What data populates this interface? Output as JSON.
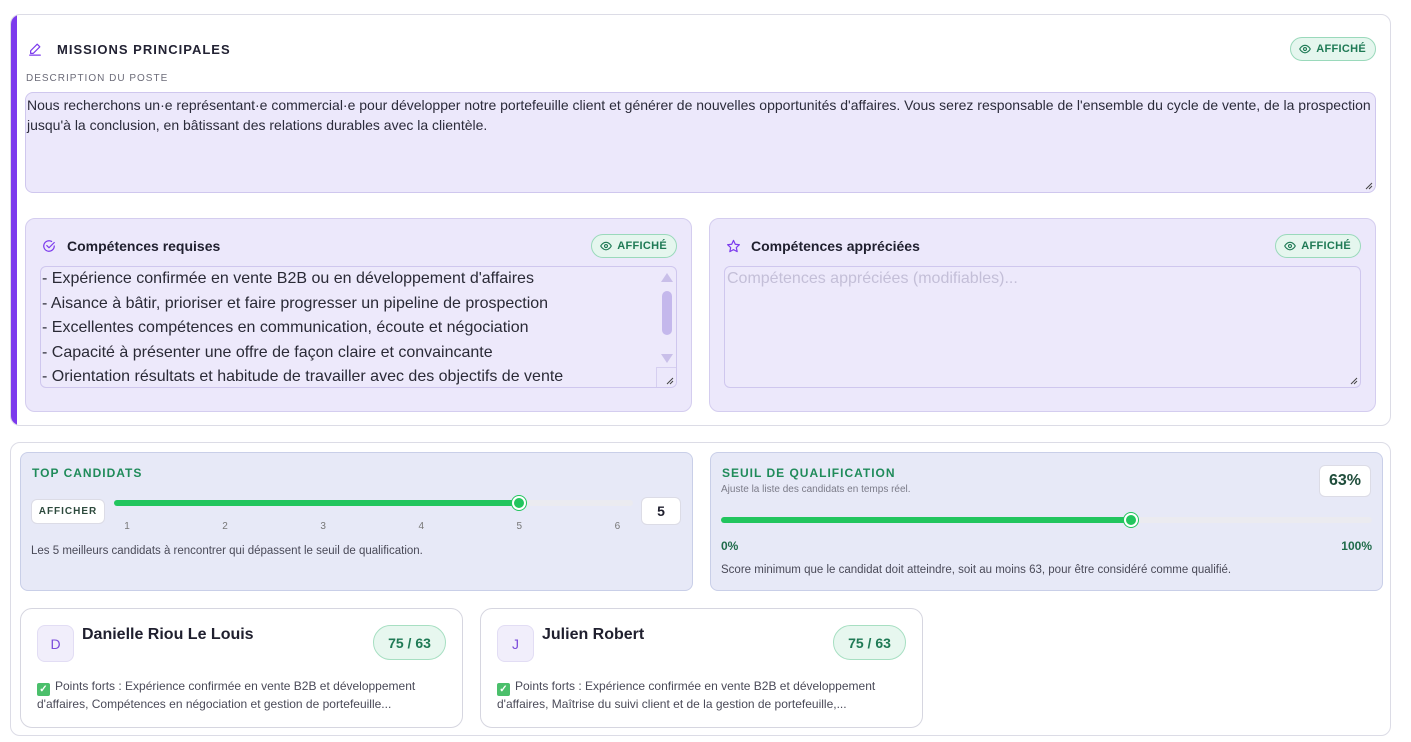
{
  "missions": {
    "title": "MISSIONS PRINCIPALES",
    "badge": "AFFICHÉ",
    "description_label": "DESCRIPTION DU POSTE",
    "description": "Nous recherchons un·e représentant·e commercial·e pour développer notre portefeuille client et générer de nouvelles opportunités d'affaires. Vous serez responsable de l'ensemble du cycle de vente, de la prospection jusqu'à la conclusion, en bâtissant des relations durables avec la clientèle."
  },
  "required_skills": {
    "title": "Compétences requises",
    "badge": "AFFICHÉ",
    "items": [
      "- Expérience confirmée en vente B2B ou en développement d'affaires",
      "- Aisance à bâtir, prioriser et faire progresser un pipeline de prospection",
      "- Excellentes compétences en communication, écoute et négociation",
      "- Capacité à présenter une offre de façon claire et convaincante",
      "- Orientation résultats et habitude de travailler avec des objectifs de vente"
    ]
  },
  "preferred_skills": {
    "title": "Compétences appréciées",
    "badge": "AFFICHÉ",
    "placeholder": "Compétences appréciées (modifiables)..."
  },
  "top_candidates": {
    "title": "TOP CANDIDATS",
    "button": "AFFICHER",
    "ticks": [
      "1",
      "2",
      "3",
      "4",
      "5",
      "6"
    ],
    "min": 1,
    "max": 6,
    "value": 5,
    "value_label": "5",
    "description": "Les 5 meilleurs candidats à rencontrer qui dépassent le seuil de qualification."
  },
  "threshold": {
    "title": "SEUIL DE QUALIFICATION",
    "subtitle": "Ajuste la liste des candidats en temps réel.",
    "value": 63,
    "value_label": "63%",
    "min_label": "0%",
    "max_label": "100%",
    "description": "Score minimum que le candidat doit atteindre, soit au moins 63, pour être considéré comme qualifié."
  },
  "candidates": [
    {
      "initial": "D",
      "name": "Danielle Riou Le Louis",
      "score": "75 / 63",
      "strengths": "Points forts : Expérience confirmée en vente B2B et développement d'affaires, Compétences en négociation et gestion de portefeuille..."
    },
    {
      "initial": "J",
      "name": "Julien Robert",
      "score": "75 / 63",
      "strengths": "Points forts : Expérience confirmée en vente B2B et développement d'affaires, Maîtrise du suivi client et de la gestion de portefeuille,..."
    }
  ],
  "colors": {
    "accent": "#7c3aed",
    "green": "#22c55e",
    "lavender": "#ece8fb"
  }
}
